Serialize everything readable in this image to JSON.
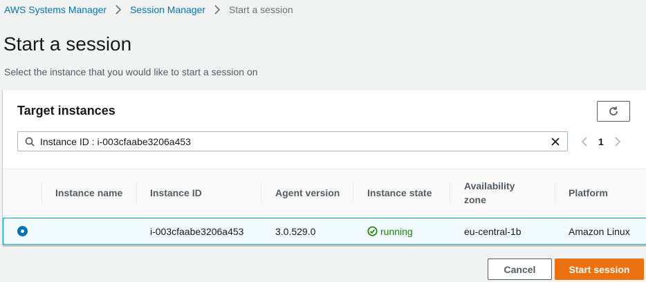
{
  "breadcrumb": {
    "items": [
      "AWS Systems Manager",
      "Session Manager"
    ],
    "current": "Start a session"
  },
  "page": {
    "title": "Start a session",
    "description": "Select the instance that you would like to start a session on"
  },
  "panel": {
    "title": "Target instances",
    "search_value": "Instance ID : i-003cfaabe3206a453",
    "page_number": "1"
  },
  "table": {
    "columns": {
      "instance_name": "Instance name",
      "instance_id": "Instance ID",
      "agent_version": "Agent version",
      "instance_state": "Instance state",
      "availability_zone": "Availability zone",
      "platform": "Platform"
    },
    "rows": [
      {
        "selected": true,
        "instance_name": "",
        "instance_id": "i-003cfaabe3206a453",
        "agent_version": "3.0.529.0",
        "instance_state": "running",
        "availability_zone": "eu-central-1b",
        "platform": "Amazon Linux"
      }
    ]
  },
  "actions": {
    "cancel": "Cancel",
    "start": "Start session"
  },
  "colors": {
    "link": "#0073bb",
    "primary": "#ec7211",
    "running": "#1d8102",
    "selected_row_bg": "#f1faff",
    "selected_row_border": "#00a1c9"
  },
  "icons": {
    "breadcrumb_separator": "chevron-right-icon",
    "refresh": "refresh-icon",
    "search": "search-icon",
    "clear": "close-icon",
    "pager_prev": "chevron-left-icon",
    "pager_next": "chevron-right-icon",
    "running": "check-circle-icon"
  }
}
